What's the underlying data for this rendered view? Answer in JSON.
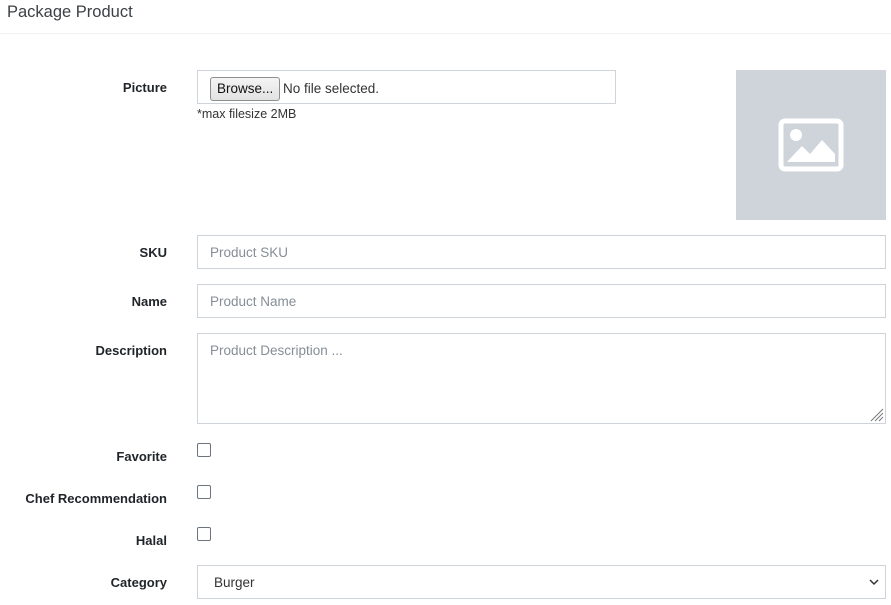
{
  "page": {
    "title": "Package Product"
  },
  "picture": {
    "label": "Picture",
    "browse_label": "Browse...",
    "file_status": "No file selected.",
    "hint": "*max filesize 2MB",
    "preview_icon": "image-icon"
  },
  "sku": {
    "label": "SKU",
    "placeholder": "Product SKU",
    "value": ""
  },
  "name": {
    "label": "Name",
    "placeholder": "Product Name",
    "value": ""
  },
  "description": {
    "label": "Description",
    "placeholder": "Product Description ...",
    "value": ""
  },
  "favorite": {
    "label": "Favorite",
    "checked": false
  },
  "chef_recommendation": {
    "label": "Chef Recommendation",
    "checked": false
  },
  "halal": {
    "label": "Halal",
    "checked": false
  },
  "category": {
    "label": "Category",
    "selected": "Burger"
  },
  "colors": {
    "border": "#ced4da",
    "preview_bg": "#ced4d9",
    "placeholder": "#868e96"
  }
}
